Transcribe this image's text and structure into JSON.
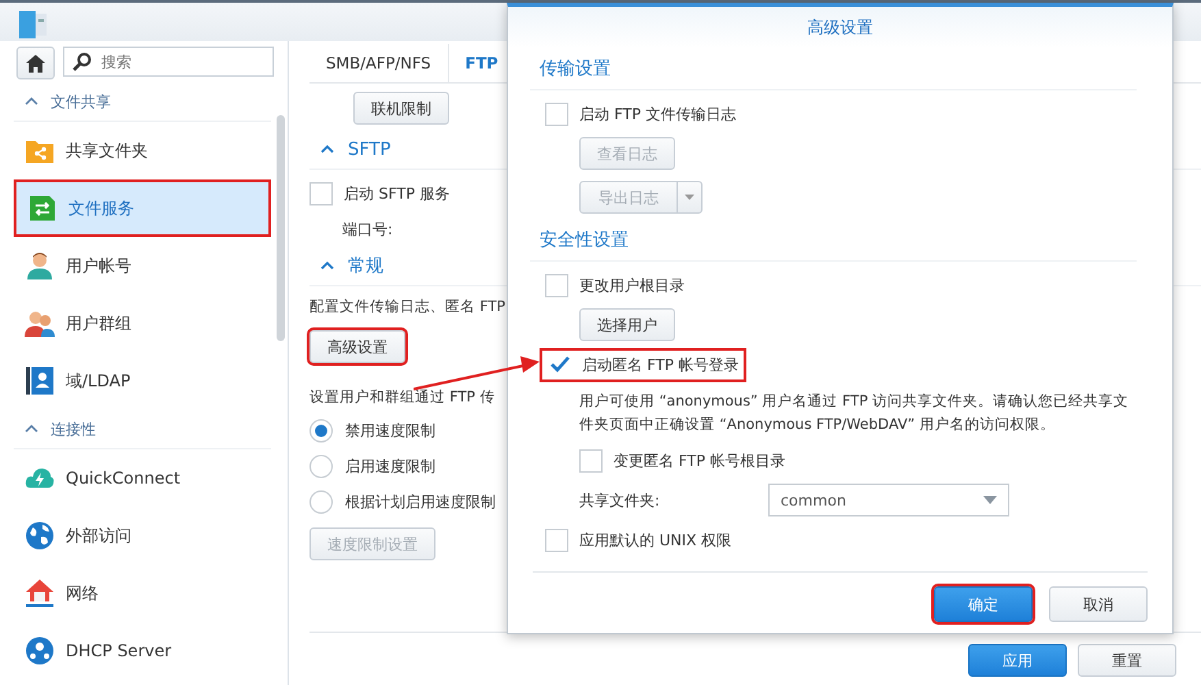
{
  "sidebar": {
    "search": {
      "placeholder": "搜索"
    },
    "groups": [
      {
        "title": "文件共享",
        "expanded": true,
        "items": [
          {
            "label": "共享文件夹",
            "selected": false,
            "highlighted": false
          },
          {
            "label": "文件服务",
            "selected": true,
            "highlighted": true
          },
          {
            "label": "用户帐号",
            "selected": false,
            "highlighted": false
          },
          {
            "label": "用户群组",
            "selected": false,
            "highlighted": false
          },
          {
            "label": "域/LDAP",
            "selected": false,
            "highlighted": false
          }
        ]
      },
      {
        "title": "连接性",
        "expanded": true,
        "items": [
          {
            "label": "QuickConnect",
            "selected": false,
            "highlighted": false
          },
          {
            "label": "外部访问",
            "selected": false,
            "highlighted": false
          },
          {
            "label": "网络",
            "selected": false,
            "highlighted": false
          },
          {
            "label": "DHCP Server",
            "selected": false,
            "highlighted": false
          }
        ]
      }
    ]
  },
  "tabs": [
    {
      "label": "SMB/AFP/NFS",
      "selected": false
    },
    {
      "label": "FTP",
      "selected": true
    }
  ],
  "main": {
    "connection_button": "联机限制",
    "sftp": {
      "title": "SFTP",
      "enable": {
        "label": "启动 SFTP 服务",
        "checked": false
      },
      "port_label": "端口号:"
    },
    "general": {
      "title": "常规",
      "description": "配置文件传输日志、匿名 FTP",
      "advanced_button": {
        "label": "高级设置",
        "highlighted": true
      },
      "speed_description": "设置用户和群组通过 FTP 传",
      "speed_options": [
        {
          "label": "禁用速度限制",
          "selected": true
        },
        {
          "label": "启用速度限制",
          "selected": false
        },
        {
          "label": "根据计划启用速度限制",
          "selected": false
        }
      ],
      "speed_button": {
        "label": "速度限制设置",
        "disabled": true
      }
    },
    "footer": {
      "apply": "应用",
      "reset": "重置"
    }
  },
  "dialog": {
    "title": "高级设置",
    "transfer": {
      "title": "传输设置",
      "log": {
        "label": "启动 FTP 文件传输日志",
        "checked": false
      },
      "view_log": {
        "label": "查看日志",
        "disabled": true
      },
      "export_log": {
        "label": "导出日志",
        "disabled": true
      }
    },
    "security": {
      "title": "安全性设置",
      "change_root": {
        "label": "更改用户根目录",
        "checked": false
      },
      "select_user": "选择用户",
      "anonymous": {
        "label": "启动匿名 FTP 帐号登录",
        "checked": true,
        "highlighted": true
      },
      "anonymous_note": "用户可使用 “anonymous” 用户名通过 FTP 访问共享文件夹。请确认您已经共享文件夹页面中正确设置 “Anonymous FTP/WebDAV” 用户名的访问权限。",
      "anonymous_root": {
        "label": "变更匿名 FTP 帐号根目录",
        "checked": false
      },
      "shared_folder": {
        "label": "共享文件夹:",
        "value": "common"
      },
      "unix": {
        "label": "应用默认的 UNIX 权限",
        "checked": false
      }
    },
    "ok": {
      "label": "确定",
      "highlighted": true
    },
    "cancel": "取消"
  }
}
